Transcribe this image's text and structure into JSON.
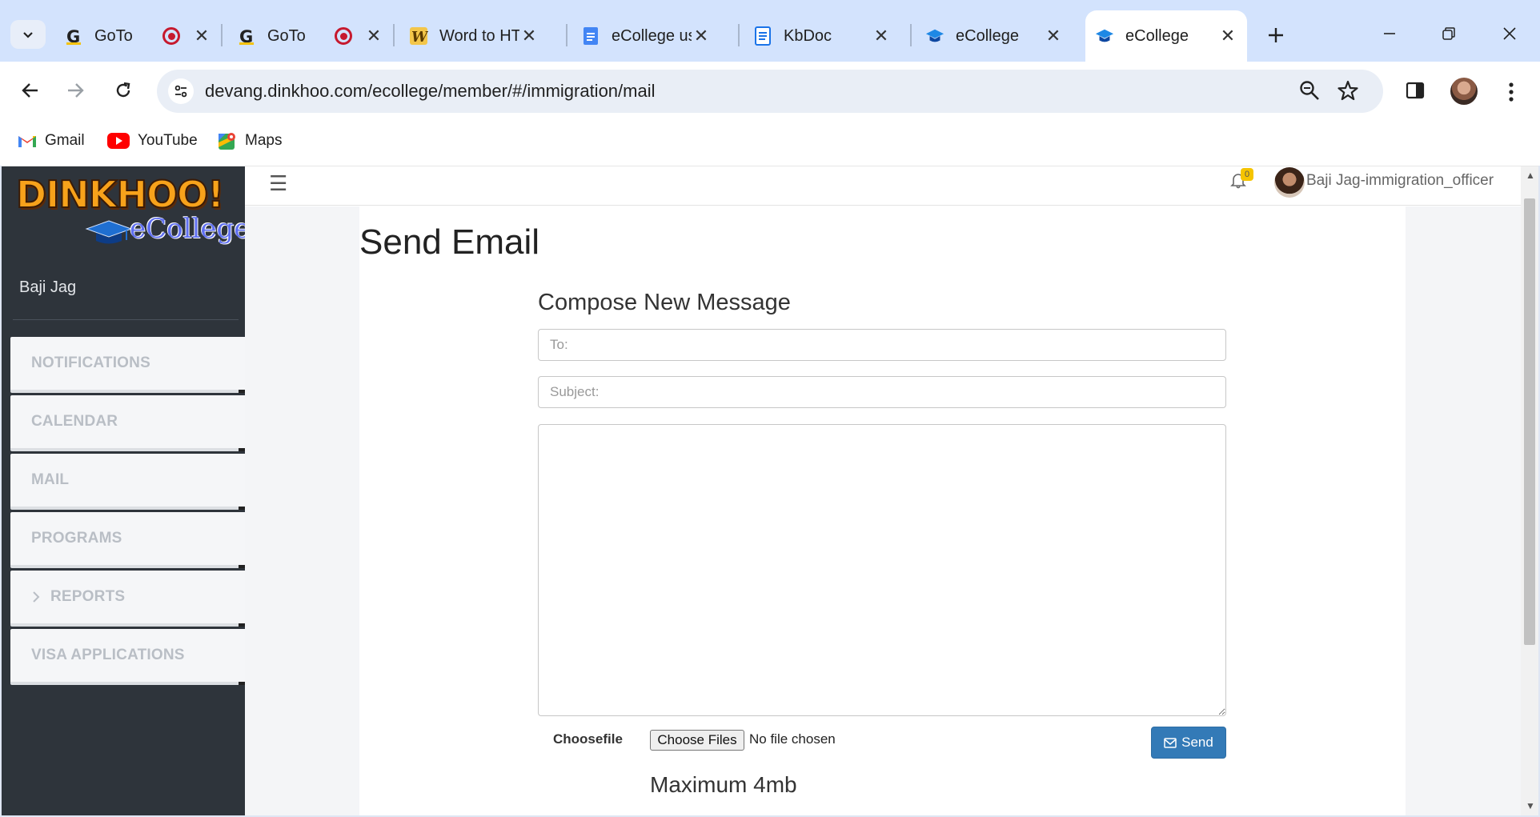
{
  "tabs": [
    {
      "title": "GoTo",
      "favicon": "google-g-icon"
    },
    {
      "title": "",
      "favicon": "record-icon"
    },
    {
      "title": "GoTo",
      "favicon": "google-g-icon"
    },
    {
      "title": "",
      "favicon": "record-icon"
    },
    {
      "title": "Word to HTML",
      "favicon": "word-to-html-icon"
    },
    {
      "title": "eCollege user",
      "favicon": "google-docs-icon"
    },
    {
      "title": "KbDoc",
      "favicon": "document-icon"
    },
    {
      "title": "eCollege",
      "favicon": "graduation-cap-icon"
    },
    {
      "title": "eCollege",
      "favicon": "graduation-cap-icon",
      "active": true
    }
  ],
  "browser": {
    "url": "devang.dinkhoo.com/ecollege/member/#/immigration/mail"
  },
  "bookmarks": [
    {
      "label": "Gmail",
      "icon": "gmail-icon"
    },
    {
      "label": "YouTube",
      "icon": "youtube-icon"
    },
    {
      "label": "Maps",
      "icon": "maps-icon"
    }
  ],
  "sidebar": {
    "logo_text": "DINKHOO!",
    "logo_subtext": "eCollege",
    "username": "Baji Jag",
    "menu": [
      {
        "label": "NOTIFICATIONS"
      },
      {
        "label": "CALENDAR"
      },
      {
        "label": "MAIL"
      },
      {
        "label": "PROGRAMS"
      },
      {
        "label": "REPORTS",
        "has_chevron": true
      },
      {
        "label": "VISA APPLICATIONS"
      }
    ]
  },
  "header": {
    "notification_count": "0",
    "user_label": "Baji Jag-immigration_officer"
  },
  "page": {
    "title": "Send Email",
    "compose_title": "Compose New Message",
    "to_placeholder": "To:",
    "subject_placeholder": "Subject:",
    "body_value": "",
    "choosefile_label": "Choosefile",
    "choose_files_button": "Choose Files",
    "no_file_text": "No file chosen",
    "send_label": "Send",
    "max_size_text": "Maximum 4mb"
  },
  "colors": {
    "tabstrip": "#d3e3fd",
    "sidebar": "#2e343b",
    "send_button": "#337ab7",
    "badge": "#f5c400"
  }
}
